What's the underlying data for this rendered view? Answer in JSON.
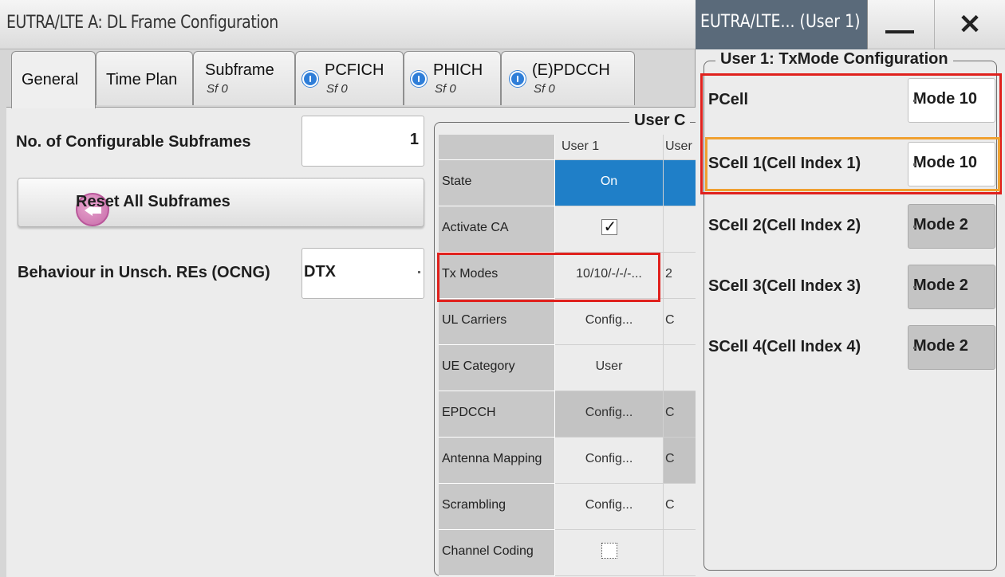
{
  "main": {
    "title": "EUTRA/LTE A: DL Frame Configuration",
    "tabs": [
      {
        "label": "General",
        "sub": ""
      },
      {
        "label": "Time Plan",
        "sub": ""
      },
      {
        "label": "Subframe",
        "sub": "Sf 0"
      },
      {
        "label": "PCFICH",
        "sub": "Sf 0"
      },
      {
        "label": "PHICH",
        "sub": "Sf 0"
      },
      {
        "label": "(E)PDCCH",
        "sub": "Sf 0"
      }
    ],
    "general": {
      "subframes_label": "No. of Configurable Subframes",
      "subframes_value": "1",
      "reset_label": "Reset All Subframes",
      "ocng_label": "Behaviour in Unsch. REs (OCNG)",
      "ocng_value": "DTX"
    },
    "user_config": {
      "group_title": "User C",
      "col_headers": [
        "User 1",
        "User"
      ],
      "rows": [
        {
          "label": "State",
          "user1": "On",
          "user2": ""
        },
        {
          "label": "Activate CA",
          "user1": "",
          "user2": ""
        },
        {
          "label": "Tx Modes",
          "user1": "10/10/-/-/-...",
          "user2": "2"
        },
        {
          "label": "UL Carriers",
          "user1": "Config...",
          "user2": "C"
        },
        {
          "label": "UE Category",
          "user1": "User",
          "user2": ""
        },
        {
          "label": "EPDCCH",
          "user1": "Config...",
          "user2": "C"
        },
        {
          "label": "Antenna Mapping",
          "user1": "Config...",
          "user2": "C"
        },
        {
          "label": "Scrambling",
          "user1": "Config...",
          "user2": "C"
        },
        {
          "label": "Channel Coding",
          "user1": "",
          "user2": ""
        }
      ]
    }
  },
  "side": {
    "title": "EUTRA/LTE... (User 1)",
    "close_glyph": "✕",
    "group_title": "User 1: TxMode Configuration",
    "cells": [
      {
        "name": "PCell",
        "mode": "Mode 10"
      },
      {
        "name": "SCell 1(Cell Index 1)",
        "mode": "Mode 10"
      },
      {
        "name": "SCell 2(Cell Index 2)",
        "mode": "Mode 2"
      },
      {
        "name": "SCell 3(Cell Index 3)",
        "mode": "Mode 2"
      },
      {
        "name": "SCell 4(Cell Index 4)",
        "mode": "Mode 2"
      }
    ]
  },
  "colors": {
    "highlight_red": "#e0211d",
    "highlight_orange": "#f0a030",
    "state_on_blue": "#1f7fc8",
    "info_icon_blue": "#2f7ed8"
  }
}
